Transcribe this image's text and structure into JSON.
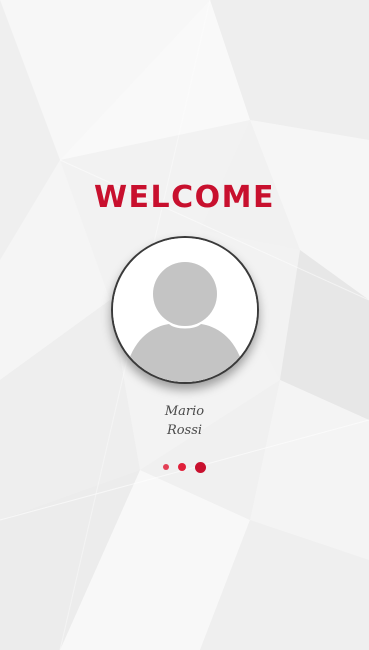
{
  "welcome": {
    "title": "WELCOME"
  },
  "profile": {
    "first_name": "Mario",
    "last_name": "Rossi",
    "avatar_icon": "user-silhouette-icon"
  },
  "pager": {
    "count": 3,
    "active_index": 2
  },
  "colors": {
    "accent": "#c8102e",
    "text": "#4a4a4a",
    "avatar_fill": "#c4c4c4"
  }
}
